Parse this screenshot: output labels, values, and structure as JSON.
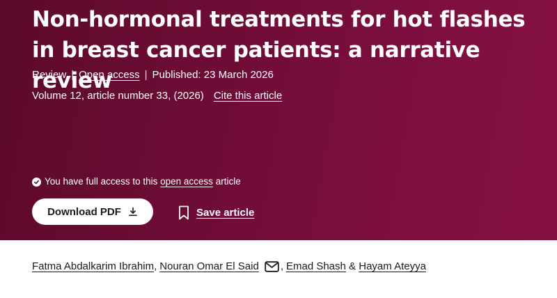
{
  "article": {
    "title": "Non-hormonal treatments for hot flashes in breast cancer patients: a narrative review",
    "type": "Review",
    "open_access_label": "Open access",
    "published": "Published: 23 March 2026",
    "volume_info": "Volume 12, article number 33, (2026)",
    "cite_label": "Cite this article"
  },
  "access_notice": {
    "prefix": "You have full access to this",
    "link": "open access",
    "suffix": "article"
  },
  "actions": {
    "download_label": "Download PDF",
    "save_label": "Save article"
  },
  "authors": {
    "list": [
      "Fatma Abdalkarim Ibrahim",
      "Nouran Omar El Said",
      "Emad Shash",
      "Hayam Ateyya"
    ],
    "comma": ",",
    "ampersand": "&"
  },
  "colors": {
    "hero_start": "#5c0a2b",
    "hero_end": "#851141",
    "text_on_hero": "#ffffff",
    "body_text": "#1a1a1a"
  },
  "icons": {
    "check": "check-circle-icon",
    "download": "download-arrow-icon",
    "save": "bookmark-icon",
    "contact": "envelope-icon"
  }
}
